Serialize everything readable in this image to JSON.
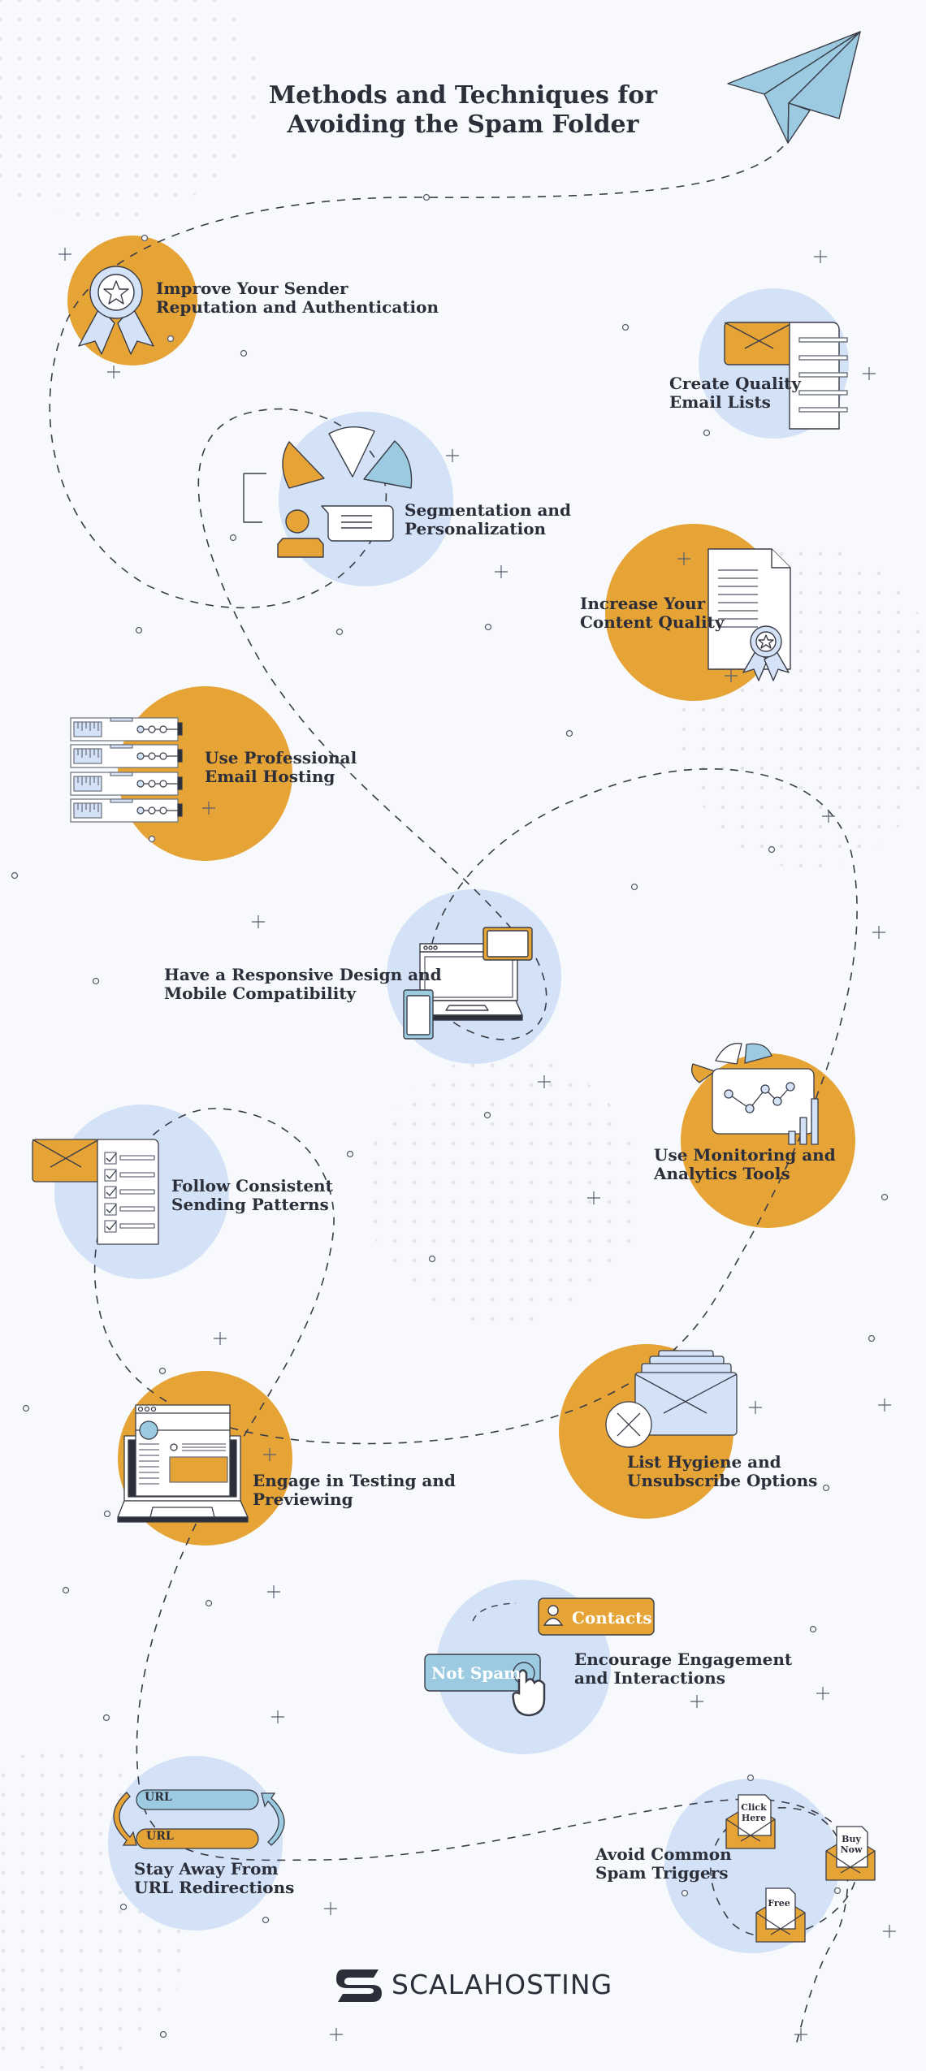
{
  "title": "Methods and Techniques for\nAvoiding the Spam Folder",
  "colors": {
    "orange": "#e6a336",
    "light_blue": "#d3e2f6",
    "sky_blue": "#9ccbe1",
    "dark": "#2c2f3a",
    "background": "#f7f9fc"
  },
  "items": [
    {
      "label": "Improve Your Sender\nReputation and Authentication",
      "icon": "award-ribbon-icon"
    },
    {
      "label": "Create Quality\nEmail Lists",
      "icon": "email-list-icon"
    },
    {
      "label": "Segmentation and\nPersonalization",
      "icon": "segmentation-icon"
    },
    {
      "label": "Increase Your\nContent Quality",
      "icon": "certificate-document-icon"
    },
    {
      "label": "Use Professional\nEmail Hosting",
      "icon": "server-rack-icon"
    },
    {
      "label": "Have a Responsive Design and\nMobile Compatibility",
      "icon": "responsive-devices-icon"
    },
    {
      "label": "Use Monitoring and\nAnalytics Tools",
      "icon": "analytics-chart-icon"
    },
    {
      "label": "Follow Consistent\nSending Patterns",
      "icon": "checklist-email-icon"
    },
    {
      "label": "List Hygiene and\nUnsubscribe Options",
      "icon": "unsubscribe-email-icon"
    },
    {
      "label": "Engage in Testing and\nPreviewing",
      "icon": "laptop-preview-icon"
    },
    {
      "label": "Encourage Engagement\nand Interactions",
      "icon": "engagement-icon"
    },
    {
      "label": "Stay Away From\nURL Redirections",
      "icon": "url-redirect-icon"
    },
    {
      "label": "Avoid Common\nSpam Triggers",
      "icon": "spam-trigger-envelopes-icon"
    }
  ],
  "illustration_text": {
    "contacts_button": "Contacts",
    "not_spam_button": "Not Spam",
    "url_top": "URL",
    "url_bottom": "URL",
    "trigger_click_here": "Click\nHere",
    "trigger_buy_now": "Buy\nNow",
    "trigger_free": "Free"
  },
  "footer": {
    "brand": "SCALAHOSTING"
  }
}
